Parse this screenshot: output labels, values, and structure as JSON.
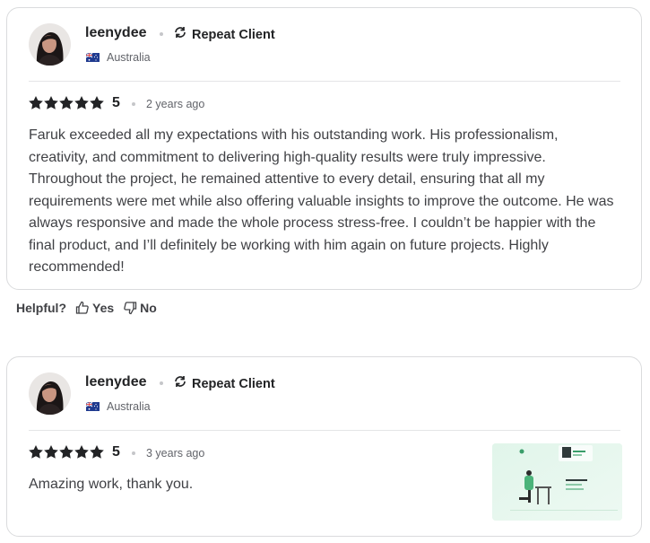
{
  "reviews": [
    {
      "username": "leenydee",
      "badge": "Repeat Client",
      "badge_icon": "repeat-icon",
      "country": "Australia",
      "country_flag": "australia-flag-icon",
      "rating": "5",
      "stars": 5,
      "time_ago": "2 years ago",
      "comment": "Faruk exceeded all my expectations with his outstanding work. His professionalism, creativity, and commitment to delivering high-quality results were truly impressive. Throughout the project, he remained attentive to every detail, ensuring that all my requirements were met while also offering valuable insights to improve the outcome. He was always responsive and made the whole process stress-free. I couldn’t be happier with the final product, and I’ll definitely be working with him again on future projects. Highly recommended!"
    },
    {
      "username": "leenydee",
      "badge": "Repeat Client",
      "badge_icon": "repeat-icon",
      "country": "Australia",
      "country_flag": "australia-flag-icon",
      "rating": "5",
      "stars": 5,
      "time_ago": "3 years ago",
      "comment": "Amazing work, thank you."
    }
  ],
  "helpful": {
    "label": "Helpful?",
    "yes_label": "Yes",
    "no_label": "No"
  },
  "colors": {
    "text_dark": "#222325",
    "text_body": "#404145",
    "text_muted": "#62646a",
    "border": "#dadbdd",
    "star": "#222325",
    "thumb_bg": "#e8f7ef"
  }
}
